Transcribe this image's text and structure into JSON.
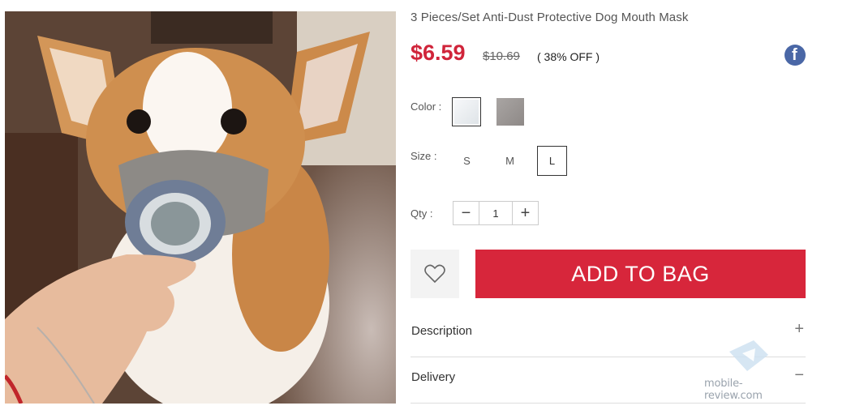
{
  "product": {
    "title": "3 Pieces/Set Anti-Dust Protective Dog Mouth Mask",
    "price": "$6.59",
    "old_price": "$10.69",
    "discount": "( 38% OFF )",
    "accent_color": "#d7263b",
    "image": "corgi wearing grey dust mask held by a hand"
  },
  "share": {
    "facebook_icon": "facebook-icon",
    "facebook_glyph": "f"
  },
  "options": {
    "color_label": "Color :",
    "colors": [
      {
        "name": "white-marble",
        "hex": "#e9ecef",
        "selected": true
      },
      {
        "name": "grey",
        "hex": "#9a9593",
        "selected": false
      }
    ],
    "size_label": "Size :",
    "sizes": [
      {
        "label": "S",
        "selected": false
      },
      {
        "label": "M",
        "selected": false
      },
      {
        "label": "L",
        "selected": true
      }
    ],
    "qty_label": "Qty :",
    "qty_minus": "−",
    "qty_value": "1",
    "qty_plus": "+"
  },
  "actions": {
    "wishlist_icon": "heart-icon",
    "add_to_bag": "ADD TO BAG"
  },
  "accordions": [
    {
      "label": "Description",
      "sign": "+"
    },
    {
      "label": "Delivery",
      "sign": "−"
    }
  ],
  "watermark": {
    "text": "mobile-review.com"
  }
}
